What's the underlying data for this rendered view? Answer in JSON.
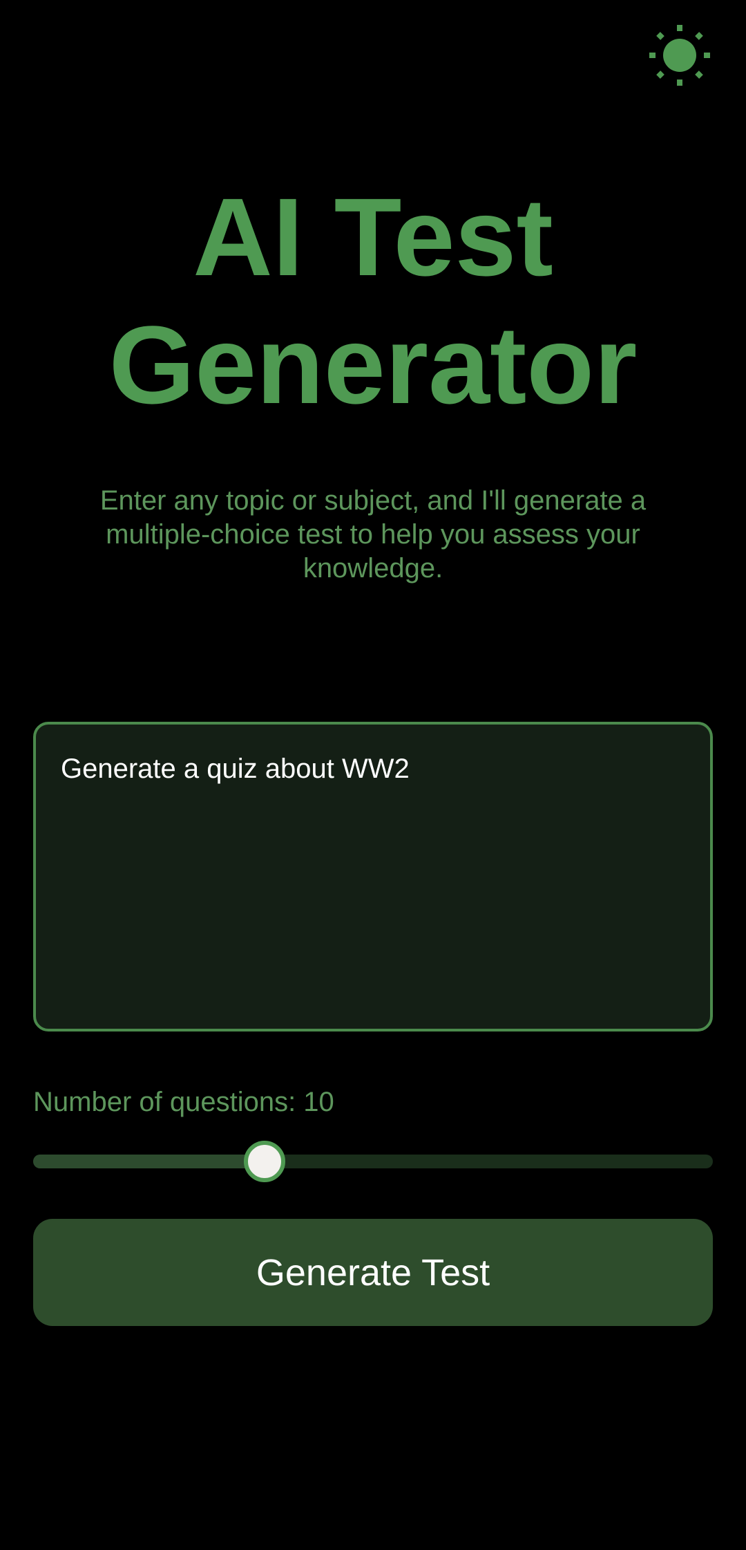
{
  "header": {
    "theme_toggle_icon": "sun-icon",
    "icon_color": "#4f9a52"
  },
  "hero": {
    "title_line1": "AI Test",
    "title_line2": "Generator",
    "subtitle": "Enter any topic or subject, and I'll generate a multiple-choice test to help you assess your knowledge."
  },
  "prompt": {
    "value": "Generate a quiz about WW2"
  },
  "question_count": {
    "label": "Number of questions: 10",
    "value": 10,
    "slider_fraction": 0.34
  },
  "actions": {
    "generate_label": "Generate Test"
  },
  "colors": {
    "accent": "#4f9a52",
    "background": "#000000",
    "button_bg": "#2e4d2c",
    "input_bg": "#141f15"
  }
}
